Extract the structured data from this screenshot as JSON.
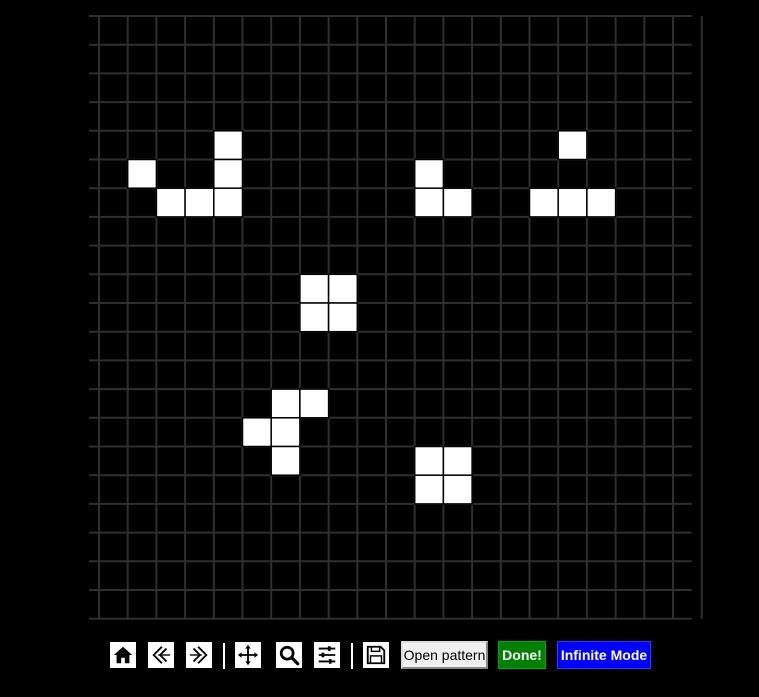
{
  "board": {
    "columns": 21,
    "rows": 21,
    "line_color": "#2f2f2f",
    "background": "#000000",
    "live_color": "#ffffff",
    "live_cells": [
      [
        4,
        4
      ],
      [
        4,
        5
      ],
      [
        1,
        5
      ],
      [
        2,
        6
      ],
      [
        3,
        6
      ],
      [
        4,
        6
      ],
      [
        11,
        5
      ],
      [
        11,
        6
      ],
      [
        12,
        6
      ],
      [
        16,
        4
      ],
      [
        15,
        6
      ],
      [
        16,
        6
      ],
      [
        17,
        6
      ],
      [
        7,
        9
      ],
      [
        8,
        9
      ],
      [
        7,
        10
      ],
      [
        8,
        10
      ],
      [
        6,
        13
      ],
      [
        7,
        13
      ],
      [
        5,
        14
      ],
      [
        6,
        14
      ],
      [
        6,
        15
      ],
      [
        11,
        15
      ],
      [
        12,
        15
      ],
      [
        11,
        16
      ],
      [
        12,
        16
      ]
    ]
  },
  "toolbar": {
    "icons": {
      "home": "home-icon",
      "undo": "undo-icon",
      "redo": "redo-icon",
      "pan": "move-icon",
      "zoom": "search-icon",
      "settings": "sliders-icon",
      "save": "save-icon"
    },
    "open_pattern_label": "Open pattern",
    "done_label": "Done!",
    "infinite_label": "Infinite Mode",
    "done_color": "#008000",
    "infinite_color": "#0000ff"
  }
}
